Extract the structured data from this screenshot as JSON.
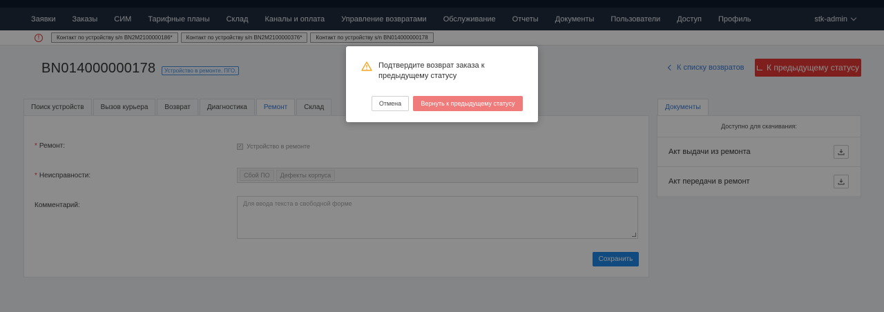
{
  "nav": {
    "items": [
      "Заявки",
      "Заказы",
      "СИМ",
      "Тарифные планы",
      "Склад",
      "Каналы и оплата",
      "Управление возвратами",
      "Обслуживание",
      "Отчеты",
      "Документы",
      "Пользователи",
      "Доступ",
      "Профиль"
    ],
    "user": "stk-admin"
  },
  "open_tabs": [
    "Контакт по устройству s/n BN2M2100000186*",
    "Контакт по устройству s/n BN2M2100000376*",
    "Контакт по устройству s/n BN014000000178"
  ],
  "page": {
    "title": "BN014000000178",
    "status_tag": "Устройство в ремонте. ПГО.",
    "back_link": "К списку возвратов",
    "prev_status_button": "К предыдущему статусу"
  },
  "tabs": [
    "Поиск устройств",
    "Вызов курьера",
    "Возврат",
    "Диагностика",
    "Ремонт",
    "Склад"
  ],
  "active_tab": "Ремонт",
  "form": {
    "repair_label": "Ремонт:",
    "repair_checkbox_label": "Устройство в ремонте",
    "faults_label": "Неисправности:",
    "faults": [
      "Сбой ПО",
      "Дефекты корпуса"
    ],
    "comment_label": "Комментарий:",
    "comment_placeholder": "Для ввода текста в свободной форме",
    "save_button": "Сохранить"
  },
  "documents": {
    "tab": "Документы",
    "header": "Доступно для скачивания:",
    "items": [
      "Акт выдачи из ремонта",
      "Акт передачи в ремонт"
    ]
  },
  "modal": {
    "message": "Подтвердите возврат заказа к предыдущему статусу",
    "cancel": "Отмена",
    "confirm": "Вернуть к предыдущему статусу"
  },
  "colors": {
    "navbar": "#1f2d3d",
    "accent": "#3a7bd5",
    "danger": "#e53935",
    "confirm": "#f07b7b",
    "warning": "#f5a623"
  }
}
